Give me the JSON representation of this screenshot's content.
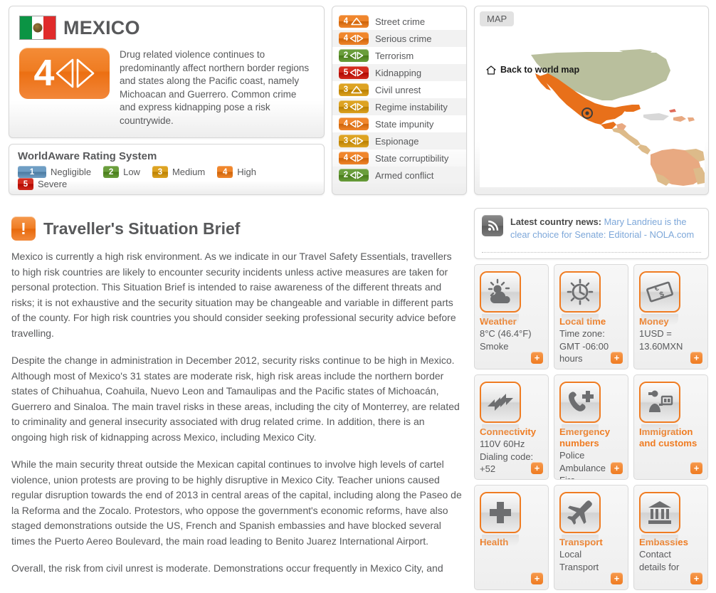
{
  "country": {
    "name": "MEXICO",
    "flag_icon": "mexico-flag-icon",
    "risk_rating": "4",
    "risk_trend_icon": "stable-arrows-icon",
    "summary": "Drug related violence continues to predominantly affect northern border regions and states along the Pacific coast, namely Michoacan and Guerrero. Common crime and express kidnapping pose a risk countrywide."
  },
  "rating_system": {
    "title": "WorldAware Rating System",
    "levels": [
      {
        "value": "1",
        "label": "Negligible",
        "color": "#6f9ec4"
      },
      {
        "value": "2",
        "label": "Low",
        "color": "#6a9e3c"
      },
      {
        "value": "3",
        "label": "Medium",
        "color": "#dda322"
      },
      {
        "value": "4",
        "label": "High",
        "color": "#f0862c"
      },
      {
        "value": "5",
        "label": "Severe",
        "color": "#d32b1e"
      }
    ]
  },
  "threats": [
    {
      "value": "4",
      "label": "Street crime",
      "color": "#f0862c",
      "trend": "rising"
    },
    {
      "value": "4",
      "label": "Serious crime",
      "color": "#f0862c",
      "trend": "stable"
    },
    {
      "value": "2",
      "label": "Terrorism",
      "color": "#6a9e3c",
      "trend": "stable"
    },
    {
      "value": "5",
      "label": "Kidnapping",
      "color": "#d32b1e",
      "trend": "stable"
    },
    {
      "value": "3",
      "label": "Civil unrest",
      "color": "#dda322",
      "trend": "rising"
    },
    {
      "value": "3",
      "label": "Regime instability",
      "color": "#dda322",
      "trend": "stable"
    },
    {
      "value": "4",
      "label": "State impunity",
      "color": "#f0862c",
      "trend": "stable"
    },
    {
      "value": "3",
      "label": "Espionage",
      "color": "#dda322",
      "trend": "stable"
    },
    {
      "value": "4",
      "label": "State corruptibility",
      "color": "#f0862c",
      "trend": "stable"
    },
    {
      "value": "2",
      "label": "Armed conflict",
      "color": "#6a9e3c",
      "trend": "stable"
    }
  ],
  "map": {
    "tab_label": "MAP",
    "back_link": "Back to world map",
    "home_icon": "home-icon",
    "highlight_color": "#e8701a"
  },
  "brief": {
    "icon": "exclamation-icon",
    "title": "Traveller's Situation Brief",
    "paragraphs": [
      "Mexico is currently a high risk environment. As we indicate in our Travel Safety Essentials, travellers to high risk countries are likely to encounter security incidents unless active measures are taken for personal protection. This Situation Brief is intended to raise awareness of the different threats and risks; it is not exhaustive and the security situation may be changeable and variable in different parts of the county. For high risk countries you should consider seeking professional security advice before travelling.",
      "Despite the change in administration in December 2012, security risks continue to be high in Mexico. Although most of Mexico's 31 states are moderate risk, high risk areas include the northern border states of Chihuahua, Coahuila, Nuevo Leon and Tamaulipas and the Pacific states of Michoacán, Guerrero and Sinaloa. The main travel risks in these areas, including the city of Monterrey, are related to criminality and general insecurity associated with drug related crime. In addition, there is an ongoing high risk of kidnapping across Mexico, including Mexico City.",
      "While the main security threat outside the Mexican capital continues to involve high levels of cartel violence, union protests are proving to be highly disruptive in Mexico City. Teacher unions caused regular disruption towards the end of 2013 in central areas of the capital, including along the Paseo de la Reforma and the Zocalo. Protestors, who oppose the government's economic reforms, have also staged demonstrations outside the US, French and Spanish embassies and have blocked several times the Puerto Aereo Boulevard, the main road leading to Benito Juarez International Airport.",
      "Overall, the risk from civil unrest is moderate. Demonstrations occur frequently in Mexico City, and"
    ]
  },
  "news": {
    "icon": "rss-icon",
    "label": "Latest country news:",
    "headline": "Mary Landrieu is the clear choice for Senate: Editorial - NOLA.com"
  },
  "tiles": [
    {
      "title": "Weather",
      "icon": "weather-icon",
      "lines": [
        "8°C (46.4°F)",
        "Smoke"
      ],
      "expand": "+"
    },
    {
      "title": "Local time",
      "icon": "clock-icon",
      "lines": [
        "Time zone:",
        "GMT -06:00",
        "hours"
      ],
      "expand": "+"
    },
    {
      "title": "Money",
      "icon": "money-icon",
      "lines": [
        "1USD =",
        "13.60MXN"
      ],
      "expand": "+"
    },
    {
      "title": "Connectivity",
      "icon": "plug-icon",
      "lines": [
        "110V 60Hz",
        "Dialing code:",
        "+52"
      ],
      "expand": "+"
    },
    {
      "title": "Emergency numbers",
      "icon": "emergency-icon",
      "lines": [
        "Police",
        "Ambulance",
        "Fire"
      ],
      "expand": "+"
    },
    {
      "title": "Immigration and customs",
      "icon": "passport-icon",
      "lines": [],
      "expand": "+"
    },
    {
      "title": "Health",
      "icon": "health-icon",
      "lines": [],
      "expand": "+"
    },
    {
      "title": "Transport",
      "icon": "airplane-icon",
      "lines": [
        "Local",
        "Transport"
      ],
      "expand": "+"
    },
    {
      "title": "Embassies",
      "icon": "embassy-icon",
      "lines": [
        "Contact",
        "details for"
      ],
      "expand": "+"
    }
  ]
}
